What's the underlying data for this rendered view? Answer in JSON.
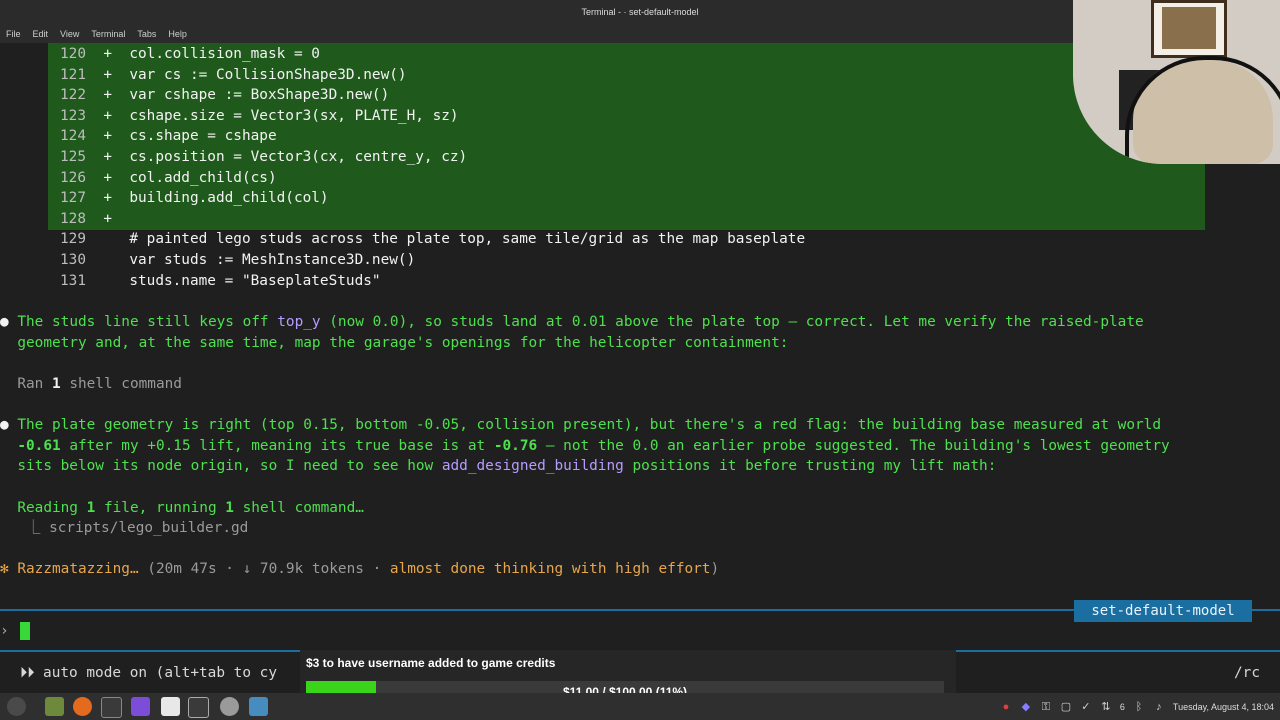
{
  "window": {
    "title": "Terminal - · set-default-model"
  },
  "menu": [
    "File",
    "Edit",
    "View",
    "Terminal",
    "Tabs",
    "Help"
  ],
  "diff": {
    "added": [
      {
        "num": "120",
        "mark": "+",
        "code": "col.collision_mask = 0"
      },
      {
        "num": "121",
        "mark": "+",
        "code": "var cs := CollisionShape3D.new()"
      },
      {
        "num": "122",
        "mark": "+",
        "code": "var cshape := BoxShape3D.new()"
      },
      {
        "num": "123",
        "mark": "+",
        "code": "cshape.size = Vector3(sx, PLATE_H, sz)"
      },
      {
        "num": "124",
        "mark": "+",
        "code": "cs.shape = cshape"
      },
      {
        "num": "125",
        "mark": "+",
        "code": "cs.position = Vector3(cx, centre_y, cz)"
      },
      {
        "num": "126",
        "mark": "+",
        "code": "col.add_child(cs)"
      },
      {
        "num": "127",
        "mark": "+",
        "code": "building.add_child(col)"
      },
      {
        "num": "128",
        "mark": "+",
        "code": ""
      }
    ],
    "context": [
      {
        "num": "129",
        "code": "# painted lego studs across the plate top, same tile/grid as the map baseplate"
      },
      {
        "num": "130",
        "code": "var studs := MeshInstance3D.new()"
      },
      {
        "num": "131",
        "code": "studs.name = \"BaseplateStuds\""
      }
    ]
  },
  "messages": {
    "m1": {
      "bullet": "●",
      "a": "The studs line still keys off ",
      "code": "top_y",
      "b": " (now 0.0), so studs land at 0.01 above the plate top — correct. Let me verify the raised-plate",
      "c": "geometry and, at the same time, map the garage's openings for the helicopter containment:"
    },
    "ran": {
      "a": "Ran ",
      "n": "1",
      "b": " shell command"
    },
    "m2": {
      "bullet": "●",
      "l1": "The plate geometry is right (top 0.15, bottom -0.05, collision present), but there's a red flag: the building base measured at world",
      "l2a": "-0.61",
      "l2b": " after my +0.15 lift, meaning its true base is at ",
      "l2c": "-0.76",
      "l2d": " — not the 0.0 an earlier probe suggested. The building's lowest geometry",
      "l3a": "sits below its node origin, so I need to see how ",
      "l3code": "add_designed_building",
      "l3b": " positions it before trusting my lift math:"
    },
    "reading": {
      "a": "Reading ",
      "n1": "1",
      "b": " file, running ",
      "n2": "1",
      "c": " shell command…"
    },
    "file": {
      "prefix": "⎿",
      "path": "scripts/lego_builder.gd"
    },
    "status": {
      "star": "✻",
      "word": "Razzmatazzing…",
      "detail": " (20m 47s · ↓ 70.9k tokens · ",
      "effort": "almost done thinking with high effort",
      "close": ")"
    }
  },
  "model_tag": "set-default-model",
  "prompt": {
    "symbol": "›"
  },
  "footer": {
    "left": "⏵⏵ auto mode on (alt+tab to cy",
    "right": "/rc"
  },
  "donation": {
    "title": "$3 to have username added to game credits",
    "progress_text": "$11.00 / $100.00 (11%)",
    "percent": 11
  },
  "taskbar": {
    "clock": "Tuesday, August  4, 18:04",
    "volume_level": "6",
    "apps": [
      "menu-icon",
      "files-icon",
      "firefox-icon",
      "terminal-icon",
      "obsidian-icon",
      "editor-icon",
      "terminal-active-icon",
      "chrome-icon",
      "godot-icon"
    ]
  },
  "colors": {
    "diff_bg": "#1f5a1c",
    "accent_blue": "#1b6ea0",
    "progress_green": "#3ad41a",
    "text_green": "#4ee04e"
  }
}
